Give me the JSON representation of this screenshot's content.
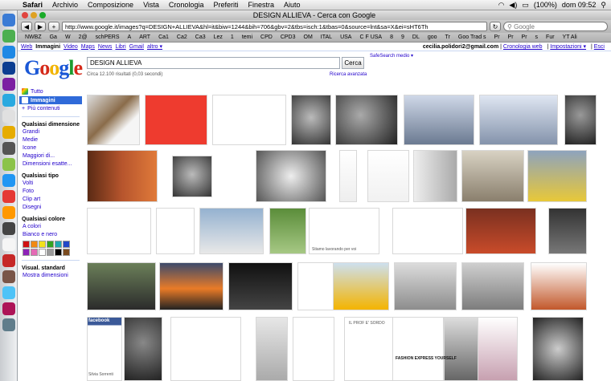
{
  "menubar": {
    "app": "Safari",
    "items": [
      "Archivio",
      "Composizione",
      "Vista",
      "Cronologia",
      "Preferiti",
      "Finestra",
      "Aiuto"
    ],
    "battery": "(100%)",
    "clock": "dom 09:52"
  },
  "window": {
    "title": "DESIGN ALLIEVA - Cerca con Google",
    "url": "http://www.google.it/images?q=DESIGN+ALLIEVA&hl=it&biw=1244&bih=706&gbv=2&tbs=isch:1&tbas=0&source=lnt&sa=X&ei=sHT6Th",
    "search_placeholder": "Google",
    "bookmarks": [
      "NWBZ",
      "Ga",
      "W",
      "2@",
      "schPERS",
      "A",
      "ART",
      "Ca1",
      "Ca2",
      "Ca3",
      "Lez",
      "1",
      "temi",
      "CPD",
      "CPD3",
      "OM",
      "ITAL",
      "USA",
      "C F USA",
      "8",
      "9",
      "DL",
      "goo",
      "Tr",
      "Goo Trad s",
      "Pr",
      "Pr",
      "Pr",
      "s",
      "Fur",
      "YT Ali"
    ]
  },
  "gbar": {
    "links": [
      "Web",
      "Immagini",
      "Video",
      "Maps",
      "News",
      "Libri",
      "Gmail",
      "altro ▾"
    ],
    "active": "Immagini",
    "user": "cecilia.polidori2@gmail.com",
    "history": "Cronologia web",
    "settings": "Impostazioni ▾",
    "exit": "Esci"
  },
  "search": {
    "query": "DESIGN ALLIEVA",
    "button": "Cerca",
    "safesearch": "SafeSearch medio ▾",
    "results": "Circa 12.100 risultati (0,03 secondi)",
    "advanced": "Ricerca avanzata"
  },
  "sidebar": {
    "categories": [
      {
        "label": "Tutto"
      },
      {
        "label": "Immagini"
      },
      {
        "label": "Più contenuti"
      }
    ],
    "size_title": "Qualsiasi dimensione",
    "sizes": [
      "Grandi",
      "Medie",
      "Icone",
      "Maggiori di...",
      "Dimensioni esatte..."
    ],
    "type_title": "Qualsiasi tipo",
    "types": [
      "Volti",
      "Foto",
      "Clip art",
      "Disegni"
    ],
    "color_title": "Qualsiasi colore",
    "colors_links": [
      "A colori",
      "Bianco e nero"
    ],
    "swatches": [
      "#d01212",
      "#f08a14",
      "#f2e11c",
      "#34a321",
      "#1fa8b0",
      "#2248c8",
      "#8d22b8",
      "#e46ab5",
      "#ffffff",
      "#9a9a9a",
      "#000000",
      "#7a4a1e"
    ],
    "view_title": "Visual. standard",
    "view_link": "Mostra dimensioni"
  },
  "grid": {
    "tile_label": "facebook",
    "tile_name": "Silvia Sorrenti",
    "poster_1": "IL PROF E' SORDO",
    "poster_2": "FASHION EXPRESS YOURSELF",
    "poster_3": "Stiamo lavorando per voi"
  }
}
